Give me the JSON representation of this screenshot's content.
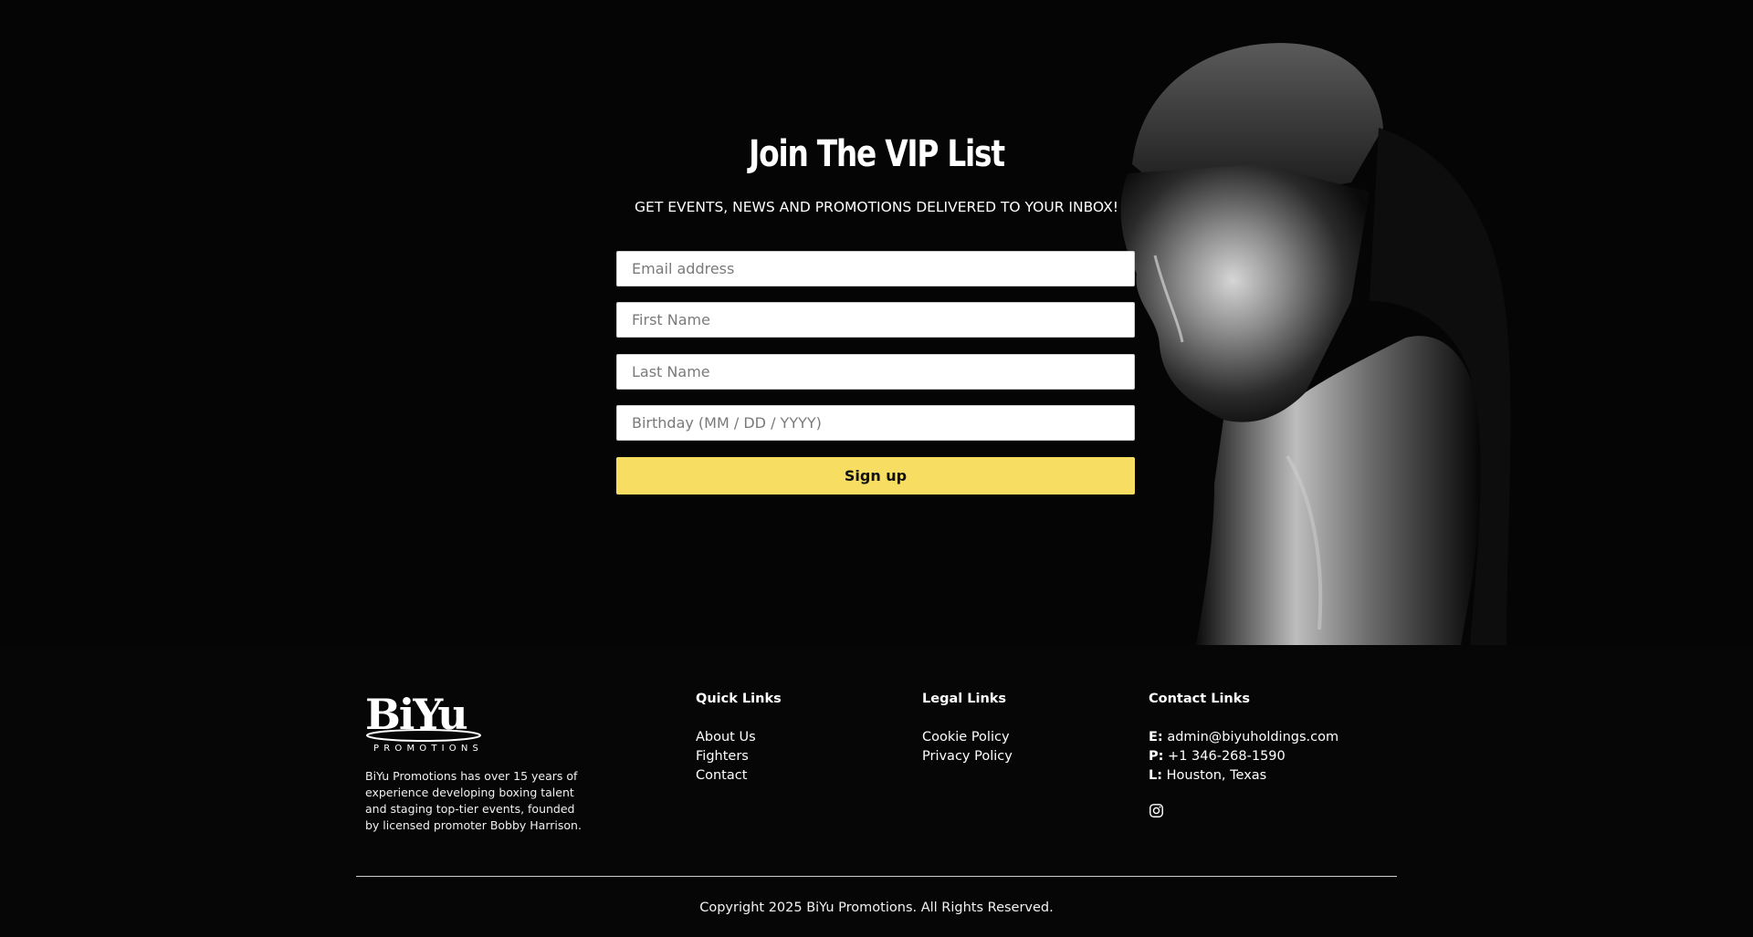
{
  "hero": {
    "title": "Join The VIP List",
    "subtitle": "GET EVENTS, NEWS AND PROMOTIONS DELIVERED TO YOUR INBOX!",
    "form": {
      "email_placeholder": "Email address",
      "first_name_placeholder": "First Name",
      "last_name_placeholder": "Last Name",
      "birthday_placeholder": "Birthday (MM / DD / YYYY)",
      "signup_label": "Sign up"
    },
    "photo_icon": "boxer-photo"
  },
  "footer": {
    "logo": {
      "wordmark": "BiYu",
      "tagline": "PROMOTIONS"
    },
    "about": "BiYu Promotions has over 15 years of experience developing boxing talent and staging top-tier events, founded by licensed promoter Bobby Harrison.",
    "quick_links": {
      "title": "Quick Links",
      "items": [
        "About Us",
        "Fighters",
        "Contact"
      ]
    },
    "legal_links": {
      "title": "Legal Links",
      "items": [
        "Cookie Policy",
        "Privacy Policy"
      ]
    },
    "contact_links": {
      "title": "Contact Links",
      "email_label": "E:",
      "email": "admin@biyuholdings.com",
      "phone_label": "P:",
      "phone": "+1 346-268-1590",
      "location_label": "L:",
      "location": "Houston, Texas",
      "social_icon": "instagram-icon"
    },
    "copyright": "Copyright 2025 BiYu Promotions. All Rights Reserved."
  },
  "colors": {
    "background": "#060606",
    "accent": "#f7de62",
    "text": "#ffffff"
  }
}
